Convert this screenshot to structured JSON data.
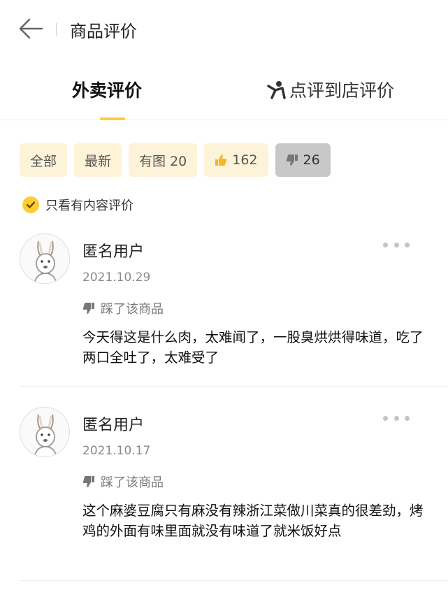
{
  "header": {
    "title": "商品评价"
  },
  "tabs": [
    {
      "label": "外卖评价"
    },
    {
      "label": "点评到店评价"
    }
  ],
  "filters": [
    {
      "label": "全部"
    },
    {
      "label": "最新"
    },
    {
      "label": "有图 20"
    },
    {
      "label": "162"
    },
    {
      "label": "26"
    }
  ],
  "content_only_label": "只看有内容评价",
  "reviews": [
    {
      "username": "匿名用户",
      "date": "2021.10.29",
      "tag": "踩了该商品",
      "text": "今天得这是什么肉，太难闻了，一股臭烘烘得味道，吃了两口全吐了，太难受了"
    },
    {
      "username": "匿名用户",
      "date": "2021.10.17",
      "tag": "踩了该商品",
      "text": "这个麻婆豆腐只有麻没有辣浙江菜做川菜真的很差劲，烤鸡的外面有味里面就没有味道了就米饭好点"
    }
  ],
  "colors": {
    "accent": "#ffcc33",
    "chip_bg": "#fdf3d8",
    "chip_active_bg": "#c8c8c8"
  },
  "icons": [
    "back-arrow-icon",
    "person-icon",
    "thumbs-up-icon",
    "thumbs-down-icon",
    "check-icon",
    "kangaroo-avatar",
    "more-dots-icon"
  ]
}
